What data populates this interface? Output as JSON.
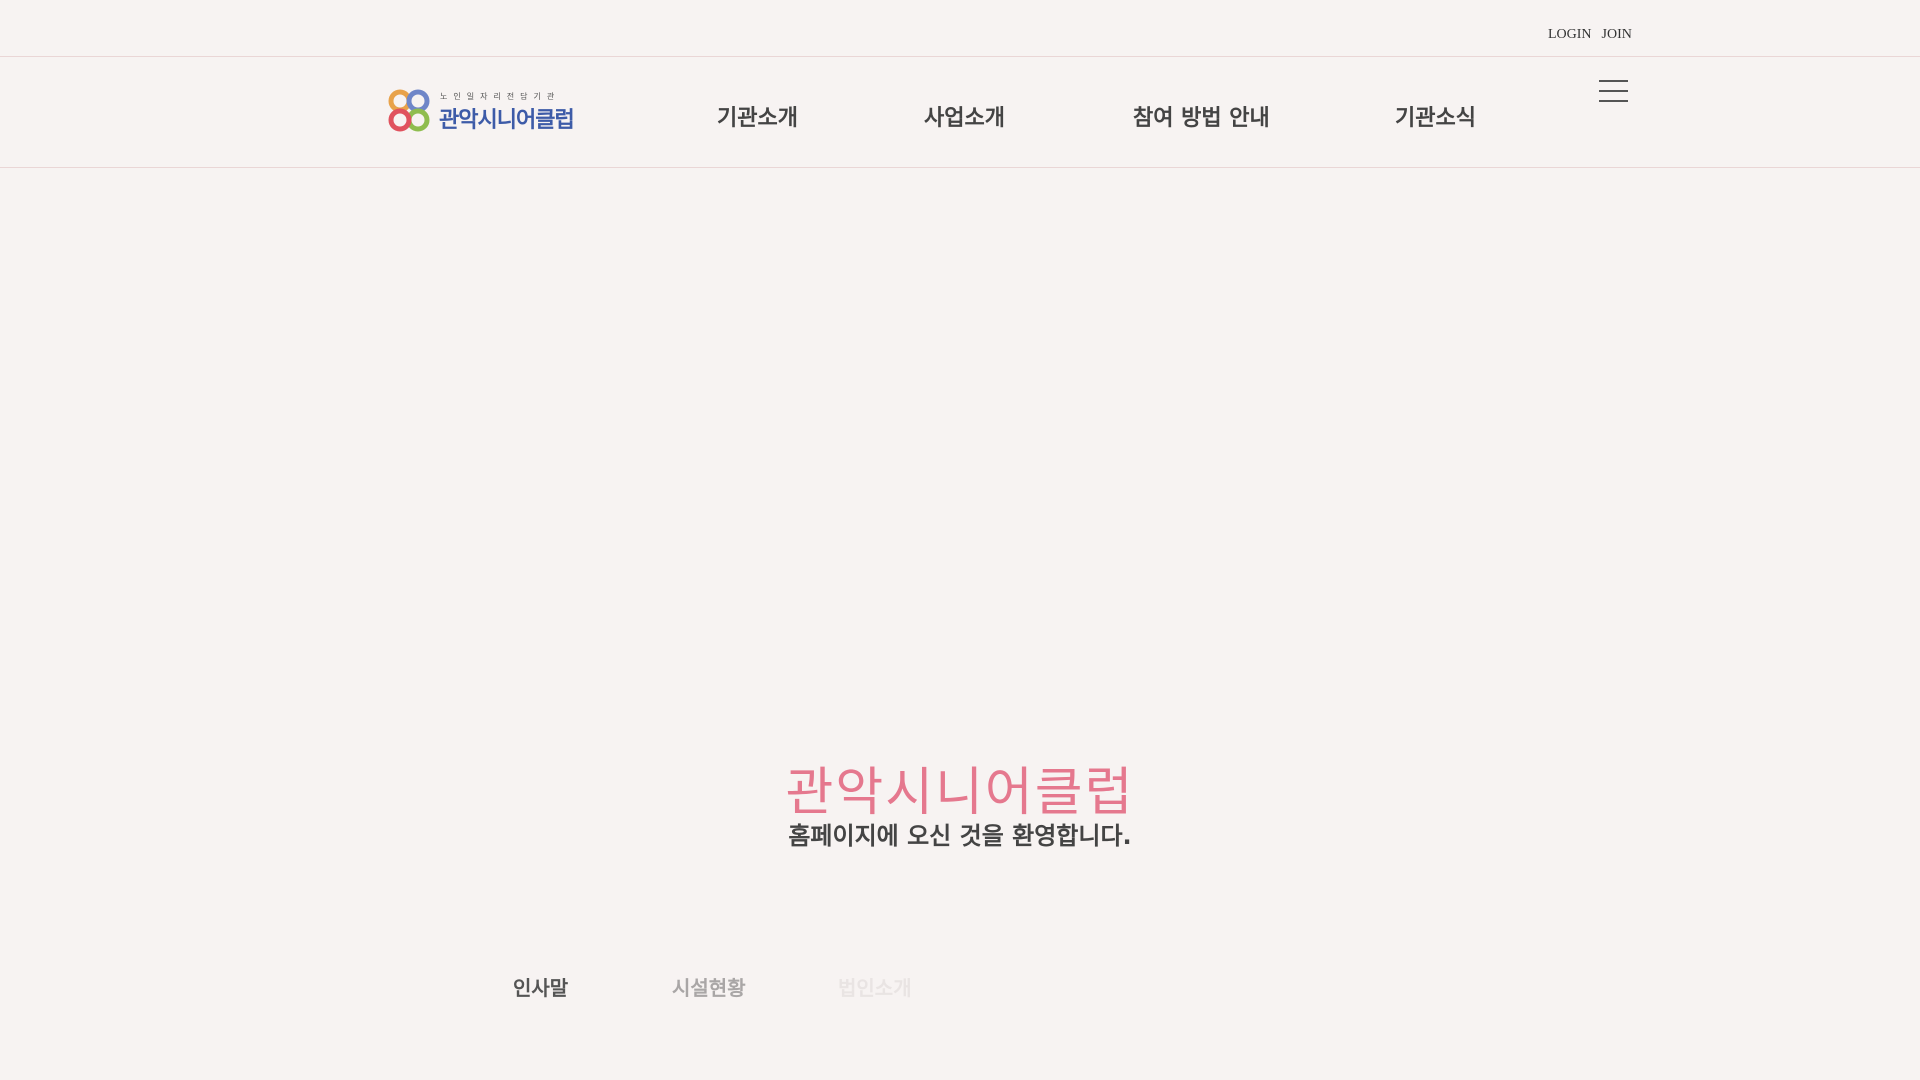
{
  "top_links": {
    "login": "LOGIN",
    "join": "JOIN"
  },
  "logo": {
    "small_text": "노인일자리전담기관",
    "name": "관악시니어클럽"
  },
  "nav": {
    "items": [
      "기관소개",
      "사업소개",
      "참여 방법 안내",
      "기관소식"
    ]
  },
  "hero": {
    "title": "관악시니어클럽",
    "subtitle": "홈페이지에 오신 것을 환영합니다."
  },
  "subnav": {
    "items": [
      "인사말",
      "시설현황",
      "법인소개"
    ]
  },
  "colors": {
    "background": "#f7f3f2",
    "accent_pink": "#e5788e",
    "logo_blue": "#3d5ba8",
    "divider": "#ead6d6"
  }
}
